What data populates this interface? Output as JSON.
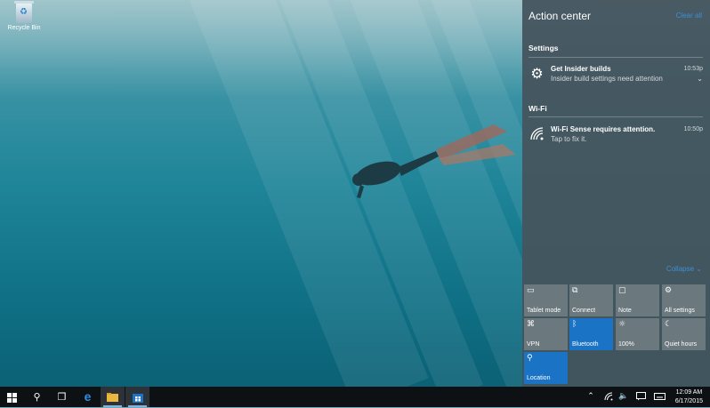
{
  "desktop": {
    "icons": [
      {
        "label": "Recycle Bin",
        "icon": "recycle-bin-icon"
      }
    ]
  },
  "action_center": {
    "title": "Action center",
    "clear_all": "Clear all",
    "groups": [
      {
        "title": "Settings",
        "notifications": [
          {
            "icon": "gear-icon",
            "title": "Get Insider builds",
            "body": "Insider build settings need attention",
            "time": "10:53p"
          }
        ]
      },
      {
        "title": "Wi-Fi",
        "notifications": [
          {
            "icon": "wifi-icon",
            "title": "Wi-Fi Sense requires attention.",
            "body": "Tap to fix it.",
            "time": "10:50p"
          }
        ]
      }
    ],
    "collapse": "Collapse",
    "quick_actions": [
      {
        "label": "Tablet mode",
        "icon": "tablet-mode-icon",
        "active": false
      },
      {
        "label": "Connect",
        "icon": "connect-icon",
        "active": false
      },
      {
        "label": "Note",
        "icon": "note-icon",
        "active": false
      },
      {
        "label": "All settings",
        "icon": "settings-icon",
        "active": false
      },
      {
        "label": "VPN",
        "icon": "vpn-icon",
        "active": false
      },
      {
        "label": "Bluetooth",
        "icon": "bluetooth-icon",
        "active": true
      },
      {
        "label": "100%",
        "icon": "brightness-icon",
        "active": false
      },
      {
        "label": "Quiet hours",
        "icon": "moon-icon",
        "active": false
      },
      {
        "label": "Location",
        "icon": "location-icon",
        "active": true
      }
    ],
    "accent": "#1a73c5"
  },
  "taskbar": {
    "apps": [
      "start-icon",
      "search-icon",
      "task-view-icon",
      "edge-icon",
      "file-explorer-icon",
      "store-icon"
    ],
    "tray": [
      "chevron-up-icon",
      "network-icon",
      "volume-icon",
      "action-center-icon",
      "keyboard-icon"
    ],
    "time": "12:09 AM",
    "date": "6/17/2015"
  }
}
